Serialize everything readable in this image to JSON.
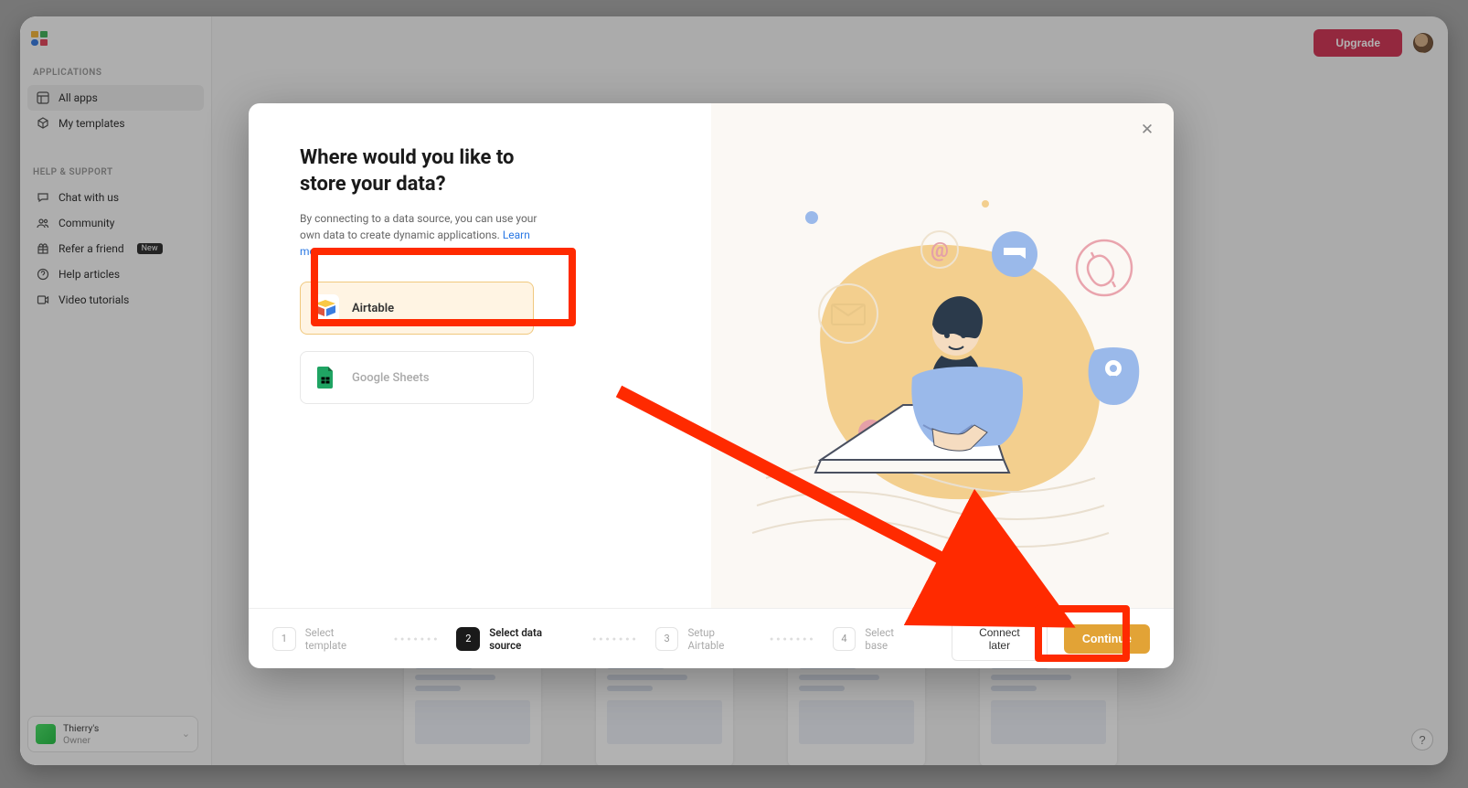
{
  "topbar": {
    "upgrade": "Upgrade"
  },
  "sidebar": {
    "applications_header": "APPLICATIONS",
    "help_header": "HELP & SUPPORT",
    "all_apps": "All apps",
    "my_templates": "My templates",
    "chat": "Chat with us",
    "community": "Community",
    "refer": "Refer a friend",
    "refer_badge": "New",
    "help_articles": "Help articles",
    "video_tutorials": "Video tutorials"
  },
  "workspace": {
    "name": "Thierry's",
    "role": "Owner"
  },
  "modal": {
    "title": "Where would you like to store your data?",
    "subtitle_a": "By connecting to a data source, you can use your own data to create dynamic applications. ",
    "learn_more": "Learn more",
    "sources": {
      "airtable": "Airtable",
      "google_sheets": "Google Sheets"
    },
    "connect_later": "Connect later",
    "continue": "Continue"
  },
  "steps": [
    {
      "n": "1",
      "label": "Select template"
    },
    {
      "n": "2",
      "label": "Select data source"
    },
    {
      "n": "3",
      "label": "Setup Airtable"
    },
    {
      "n": "4",
      "label": "Select base"
    }
  ]
}
